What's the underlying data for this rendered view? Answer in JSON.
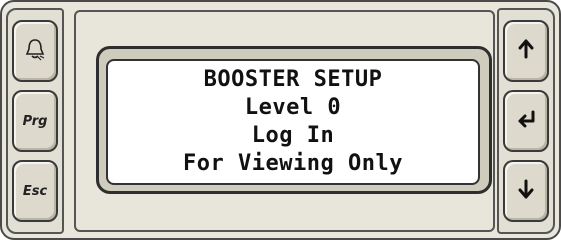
{
  "left_keys": {
    "alarm": {
      "icon": "bell-icon"
    },
    "prg": {
      "label": "Prg"
    },
    "esc": {
      "label": "Esc"
    }
  },
  "right_keys": {
    "up": {
      "icon": "arrow-up-icon"
    },
    "enter": {
      "icon": "enter-arrow-icon"
    },
    "down": {
      "icon": "arrow-down-icon"
    }
  },
  "display": {
    "lines": [
      "BOOSTER SETUP",
      "Level 0",
      "Log In",
      "For Viewing Only"
    ]
  }
}
